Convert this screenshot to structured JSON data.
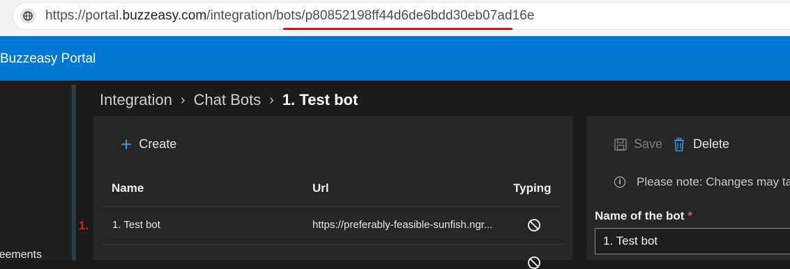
{
  "browser": {
    "url_prefix": "https://portal.",
    "url_domain": "buzzeasy.com",
    "url_path": "/integration/bots/",
    "url_id": "p80852198ff44d6de6bdd30eb07ad16e"
  },
  "app": {
    "title": "Buzzeasy Portal"
  },
  "leftnav": {
    "item_partial": "Agreements"
  },
  "breadcrumb": [
    "Integration",
    "Chat Bots",
    "1. Test bot"
  ],
  "list": {
    "create_label": "Create",
    "columns": [
      "Name",
      "Url",
      "Typing"
    ],
    "rows": [
      {
        "marker": "1.",
        "name": "1. Test bot",
        "url": "https://preferably-feasible-sunfish.ngr...",
        "typing_icon": "block-icon"
      }
    ]
  },
  "detail": {
    "save_label": "Save",
    "delete_label": "Delete",
    "note": "Please note: Changes may take",
    "name_label": "Name of the bot",
    "required_mark": "*",
    "name_value": "1. Test bot"
  },
  "colors": {
    "brand": "#0078d4",
    "marker": "#d62020",
    "accent": "#3b94e0"
  }
}
